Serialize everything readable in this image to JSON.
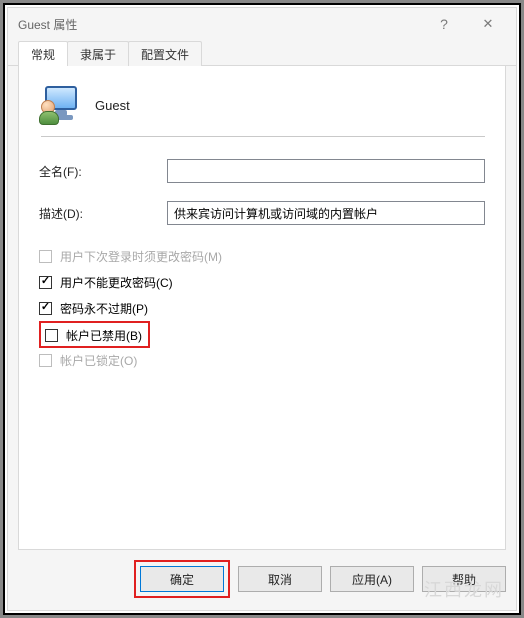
{
  "titlebar": {
    "title": "Guest 属性"
  },
  "tabs": {
    "general": "常规",
    "memberof": "隶属于",
    "profile": "配置文件"
  },
  "user": {
    "name": "Guest"
  },
  "labels": {
    "fullname": "全名(F):",
    "description": "描述(D):"
  },
  "fields": {
    "fullname": "",
    "description": "供来宾访问计算机或访问域的内置帐户"
  },
  "checks": {
    "mustchange": "用户下次登录时须更改密码(M)",
    "cannotchange": "用户不能更改密码(C)",
    "neverexpires": "密码永不过期(P)",
    "disabled": "帐户已禁用(B)",
    "locked": "帐户已锁定(O)"
  },
  "buttons": {
    "ok": "确定",
    "cancel": "取消",
    "apply": "应用(A)",
    "help": "帮助"
  },
  "watermark": "江西龙网"
}
